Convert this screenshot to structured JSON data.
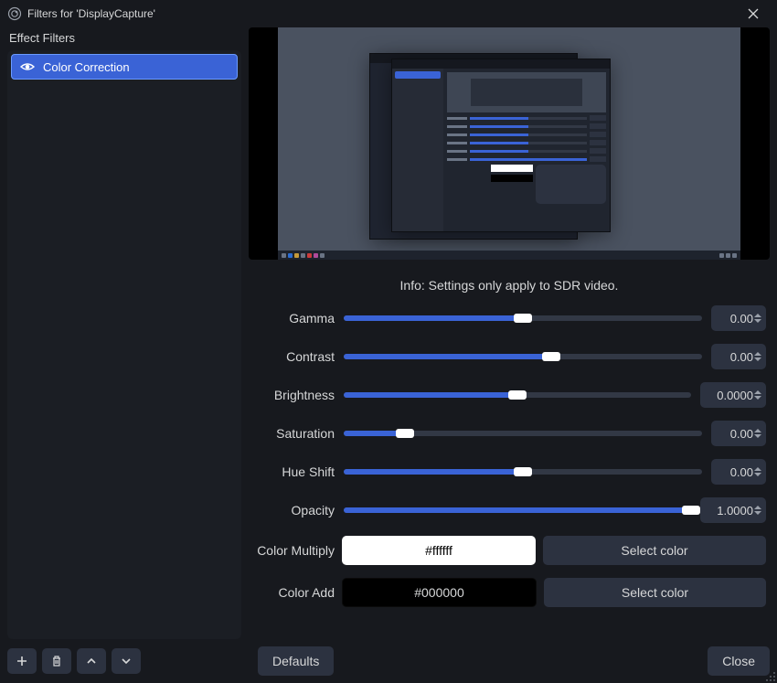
{
  "window": {
    "title": "Filters for 'DisplayCapture'"
  },
  "sidebar": {
    "header": "Effect Filters",
    "items": [
      {
        "label": "Color Correction",
        "visible": true,
        "selected": true
      }
    ]
  },
  "info": "Info: Settings only apply to SDR video.",
  "sliders": {
    "gamma": {
      "label": "Gamma",
      "value": "0.00",
      "fill_pct": 50
    },
    "contrast": {
      "label": "Contrast",
      "value": "0.00",
      "fill_pct": 58
    },
    "brightness": {
      "label": "Brightness",
      "value": "0.0000",
      "fill_pct": 50
    },
    "saturation": {
      "label": "Saturation",
      "value": "0.00",
      "fill_pct": 17
    },
    "hue_shift": {
      "label": "Hue Shift",
      "value": "0.00",
      "fill_pct": 50
    },
    "opacity": {
      "label": "Opacity",
      "value": "1.0000",
      "fill_pct": 100
    }
  },
  "colors": {
    "multiply": {
      "label": "Color Multiply",
      "hex": "#ffffff",
      "button": "Select color"
    },
    "add": {
      "label": "Color Add",
      "hex": "#000000",
      "button": "Select color"
    }
  },
  "buttons": {
    "defaults": "Defaults",
    "close": "Close"
  }
}
